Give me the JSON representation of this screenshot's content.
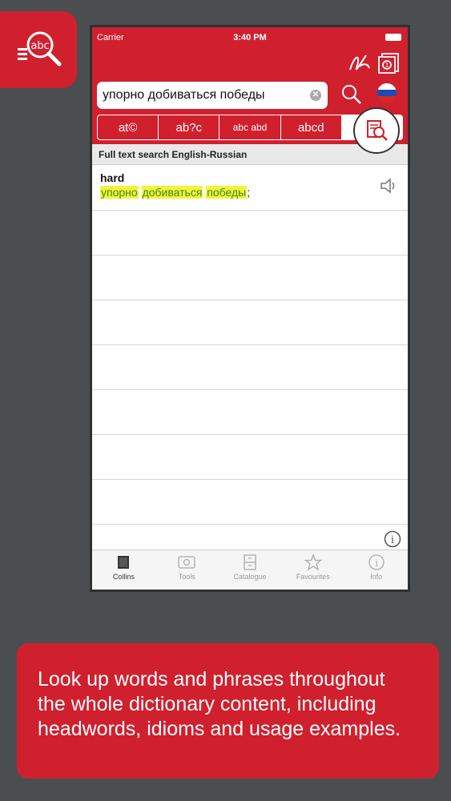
{
  "status": {
    "carrier": "Carrier",
    "time": "3:40 PM"
  },
  "search": {
    "value": "упорно добиваться победы",
    "placeholder": ""
  },
  "modes": [
    "at©",
    "ab?c",
    "abc abd",
    "abcd",
    ""
  ],
  "section_header": "Full text search English-Russian",
  "result": {
    "headword": "hard",
    "translation_parts": [
      "упорно",
      "добиваться",
      "победы"
    ],
    "translation_suffix": ";"
  },
  "tabs": [
    "Collins",
    "Tools",
    "Catalogue",
    "Favourites",
    "Info"
  ],
  "caption": "Look up words and phrases throughout the whole dictionary content, including headwords, idioms and usage examples.",
  "colors": {
    "accent": "#d0202e",
    "background": "#4a4e51",
    "highlight": "#f3f33b",
    "highlight_text": "#3a8a24"
  }
}
